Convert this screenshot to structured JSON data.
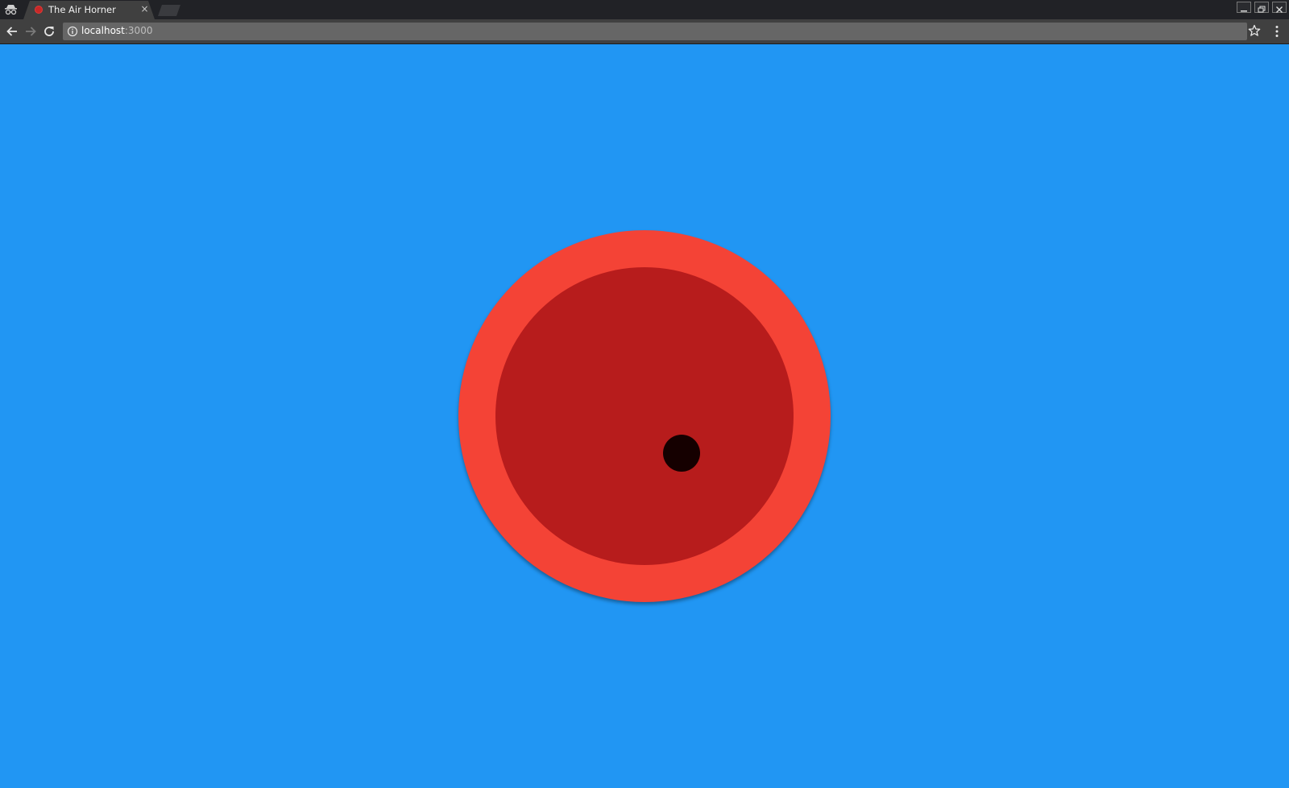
{
  "tab": {
    "title": "The Air Horner",
    "favicon": "red-circle-favicon",
    "close_glyph": "×"
  },
  "omnibox": {
    "host": "localhost",
    "port": ":3000"
  },
  "icons": {
    "incognito": "incognito-icon",
    "back": "back-arrow-icon",
    "forward": "forward-arrow-icon",
    "reload": "reload-icon",
    "info": "info-icon",
    "star": "star-icon",
    "menu": "kebab-menu-icon"
  },
  "colors": {
    "page_background": "#2196f3",
    "horn_outer": "#f44336",
    "horn_inner": "#b71c1c",
    "horn_center": "#150000"
  }
}
